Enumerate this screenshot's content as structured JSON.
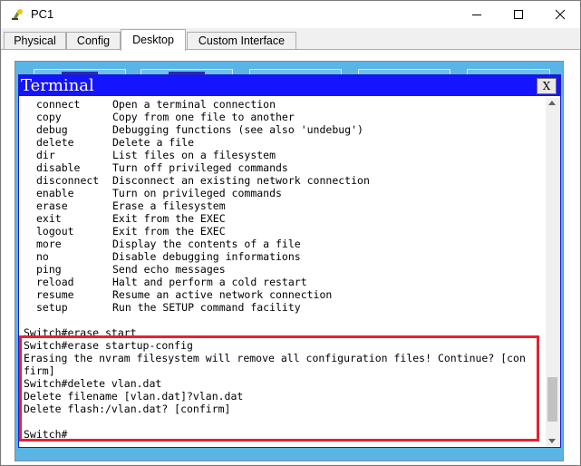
{
  "window": {
    "title": "PC1",
    "icon": "packet-tracer-pc-icon"
  },
  "tabs": [
    {
      "label": "Physical",
      "active": false
    },
    {
      "label": "Config",
      "active": false
    },
    {
      "label": "Desktop",
      "active": true
    },
    {
      "label": "Custom Interface",
      "active": false
    }
  ],
  "terminal": {
    "title": "Terminal",
    "close_label": "X",
    "help_rows": [
      {
        "cmd": "connect",
        "desc": "Open a terminal connection"
      },
      {
        "cmd": "copy",
        "desc": "Copy from one file to another"
      },
      {
        "cmd": "debug",
        "desc": "Debugging functions (see also 'undebug')"
      },
      {
        "cmd": "delete",
        "desc": "Delete a file"
      },
      {
        "cmd": "dir",
        "desc": "List files on a filesystem"
      },
      {
        "cmd": "disable",
        "desc": "Turn off privileged commands"
      },
      {
        "cmd": "disconnect",
        "desc": "Disconnect an existing network connection"
      },
      {
        "cmd": "enable",
        "desc": "Turn on privileged commands"
      },
      {
        "cmd": "erase",
        "desc": "Erase a filesystem"
      },
      {
        "cmd": "exit",
        "desc": "Exit from the EXEC"
      },
      {
        "cmd": "logout",
        "desc": "Exit from the EXEC"
      },
      {
        "cmd": "more",
        "desc": "Display the contents of a file"
      },
      {
        "cmd": "no",
        "desc": "Disable debugging informations"
      },
      {
        "cmd": "ping",
        "desc": "Send echo messages"
      },
      {
        "cmd": "reload",
        "desc": "Halt and perform a cold restart"
      },
      {
        "cmd": "resume",
        "desc": "Resume an active network connection"
      },
      {
        "cmd": "setup",
        "desc": "Run the SETUP command facility"
      }
    ],
    "output_lines": [
      "Switch#erase start",
      "Switch#erase startup-config",
      "Erasing the nvram filesystem will remove all configuration files! Continue? [con",
      "firm]",
      "Switch#delete vlan.dat",
      "Delete filename [vlan.dat]?vlan.dat",
      "Delete flash:/vlan.dat? [confirm]",
      "",
      "Switch#"
    ]
  },
  "colors": {
    "terminal_titlebar": "#1414ff",
    "desktop_background": "#5ab4e6",
    "highlight_box": "#e8212f"
  }
}
